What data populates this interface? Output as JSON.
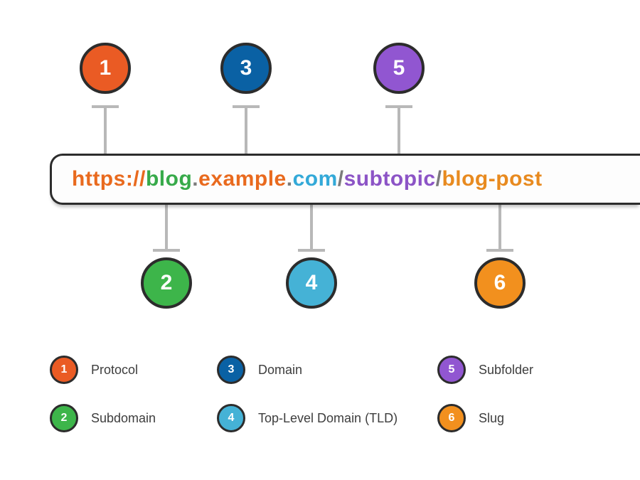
{
  "url_parts": {
    "protocol": "https://",
    "subdomain": "blog",
    "dot1": ".",
    "domain": "example",
    "dot2": ".",
    "tld": "com",
    "slash1": "/",
    "subfolder": "subtopic",
    "slash2": "/",
    "slug": "blog-post"
  },
  "markers": {
    "m1": "1",
    "m2": "2",
    "m3": "3",
    "m4": "4",
    "m5": "5",
    "m6": "6"
  },
  "legend": {
    "i1": {
      "num": "1",
      "label": "Protocol"
    },
    "i2": {
      "num": "2",
      "label": "Subdomain"
    },
    "i3": {
      "num": "3",
      "label": "Domain"
    },
    "i4": {
      "num": "4",
      "label": "Top-Level Domain (TLD)"
    },
    "i5": {
      "num": "5",
      "label": "Subfolder"
    },
    "i6": {
      "num": "6",
      "label": "Slug"
    }
  },
  "colors": {
    "protocol": "#e96a1e",
    "subdomain": "#37aa4a",
    "domain": "#0a61a4",
    "tld": "#33a9d8",
    "subfolder": "#8c54c6",
    "slug": "#e88a1f",
    "separator": "#7b7b7b"
  }
}
